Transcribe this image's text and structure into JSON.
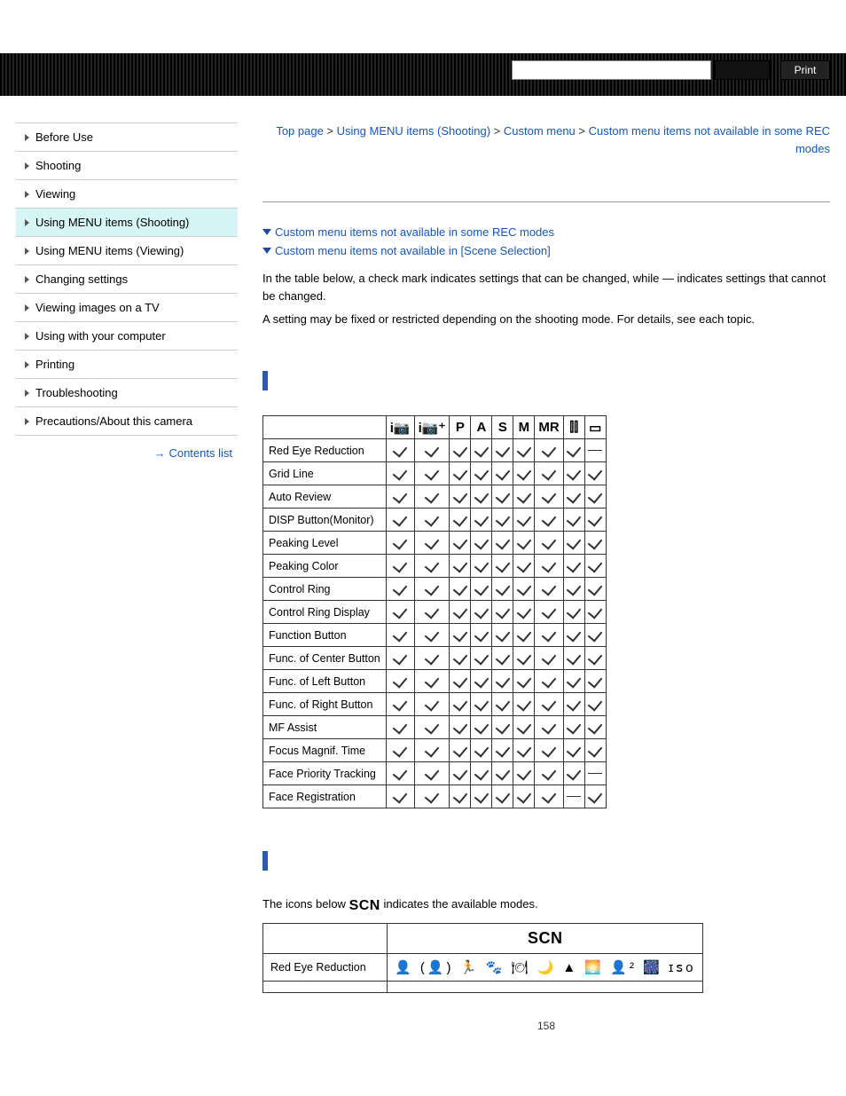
{
  "header": {
    "print_label": "Print"
  },
  "sidebar": {
    "items": [
      {
        "label": "Before Use",
        "active": false
      },
      {
        "label": "Shooting",
        "active": false
      },
      {
        "label": "Viewing",
        "active": false
      },
      {
        "label": "Using MENU items (Shooting)",
        "active": true
      },
      {
        "label": "Using MENU items (Viewing)",
        "active": false
      },
      {
        "label": "Changing settings",
        "active": false
      },
      {
        "label": "Viewing images on a TV",
        "active": false
      },
      {
        "label": "Using with your computer",
        "active": false
      },
      {
        "label": "Printing",
        "active": false
      },
      {
        "label": "Troubleshooting",
        "active": false
      },
      {
        "label": "Precautions/About this camera",
        "active": false
      }
    ],
    "contents_link": "Contents list"
  },
  "breadcrumb": {
    "sep": " > ",
    "items": [
      {
        "label": "Top page",
        "link": true
      },
      {
        "label": "Using MENU items (Shooting)",
        "link": true
      },
      {
        "label": "Custom menu",
        "link": true
      },
      {
        "label": "Custom menu items not available in some REC modes",
        "link": true
      }
    ]
  },
  "anchors": [
    "Custom menu items not available in some REC modes",
    "Custom menu items not available in [Scene Selection]"
  ],
  "intro": {
    "p1": "In the table below, a check mark indicates settings that can be changed, while — indicates settings that cannot be changed.",
    "p2": "A setting may be fixed or restricted depending on the shooting mode. For details, see each topic."
  },
  "table1": {
    "headers": [
      "iAuto",
      "iAuto+",
      "P",
      "A",
      "S",
      "M",
      "MR",
      "Sweep",
      "Movie"
    ],
    "header_glyphs": [
      "i📷",
      "i📷⁺",
      "P",
      "A",
      "S",
      "M",
      "MR",
      "⫿⫿",
      "▭"
    ],
    "rows": [
      {
        "label": "Red Eye Reduction",
        "cells": [
          "c",
          "c",
          "c",
          "c",
          "c",
          "c",
          "c",
          "c",
          "-"
        ]
      },
      {
        "label": "Grid Line",
        "cells": [
          "c",
          "c",
          "c",
          "c",
          "c",
          "c",
          "c",
          "c",
          "c"
        ]
      },
      {
        "label": "Auto Review",
        "cells": [
          "c",
          "c",
          "c",
          "c",
          "c",
          "c",
          "c",
          "c",
          "c"
        ]
      },
      {
        "label": "DISP Button(Monitor)",
        "cells": [
          "c",
          "c",
          "c",
          "c",
          "c",
          "c",
          "c",
          "c",
          "c"
        ]
      },
      {
        "label": "Peaking Level",
        "cells": [
          "c",
          "c",
          "c",
          "c",
          "c",
          "c",
          "c",
          "c",
          "c"
        ]
      },
      {
        "label": "Peaking Color",
        "cells": [
          "c",
          "c",
          "c",
          "c",
          "c",
          "c",
          "c",
          "c",
          "c"
        ]
      },
      {
        "label": "Control Ring",
        "cells": [
          "c",
          "c",
          "c",
          "c",
          "c",
          "c",
          "c",
          "c",
          "c"
        ]
      },
      {
        "label": "Control Ring Display",
        "cells": [
          "c",
          "c",
          "c",
          "c",
          "c",
          "c",
          "c",
          "c",
          "c"
        ]
      },
      {
        "label": "Function Button",
        "cells": [
          "c",
          "c",
          "c",
          "c",
          "c",
          "c",
          "c",
          "c",
          "c"
        ]
      },
      {
        "label": "Func. of Center Button",
        "cells": [
          "c",
          "c",
          "c",
          "c",
          "c",
          "c",
          "c",
          "c",
          "c"
        ]
      },
      {
        "label": "Func. of Left Button",
        "cells": [
          "c",
          "c",
          "c",
          "c",
          "c",
          "c",
          "c",
          "c",
          "c"
        ]
      },
      {
        "label": "Func. of Right Button",
        "cells": [
          "c",
          "c",
          "c",
          "c",
          "c",
          "c",
          "c",
          "c",
          "c"
        ]
      },
      {
        "label": "MF Assist",
        "cells": [
          "c",
          "c",
          "c",
          "c",
          "c",
          "c",
          "c",
          "c",
          "c"
        ]
      },
      {
        "label": "Focus Magnif. Time",
        "cells": [
          "c",
          "c",
          "c",
          "c",
          "c",
          "c",
          "c",
          "c",
          "c"
        ]
      },
      {
        "label": "Face Priority Tracking",
        "cells": [
          "c",
          "c",
          "c",
          "c",
          "c",
          "c",
          "c",
          "c",
          "-"
        ]
      },
      {
        "label": "Face Registration",
        "cells": [
          "c",
          "c",
          "c",
          "c",
          "c",
          "c",
          "c",
          "-",
          "c"
        ]
      }
    ]
  },
  "scn_section": {
    "intro_pre": "The icons below ",
    "intro_mid": "SCN",
    "intro_post": " indicates the available modes.",
    "header": "SCN",
    "row_label": "Red Eye Reduction",
    "row_icons": "👤 (👤) 🏃 🐾 🍽 🌙 ▲ 🌅 👤² 🎆 ɪꜱᴏ"
  },
  "page_number": "158"
}
